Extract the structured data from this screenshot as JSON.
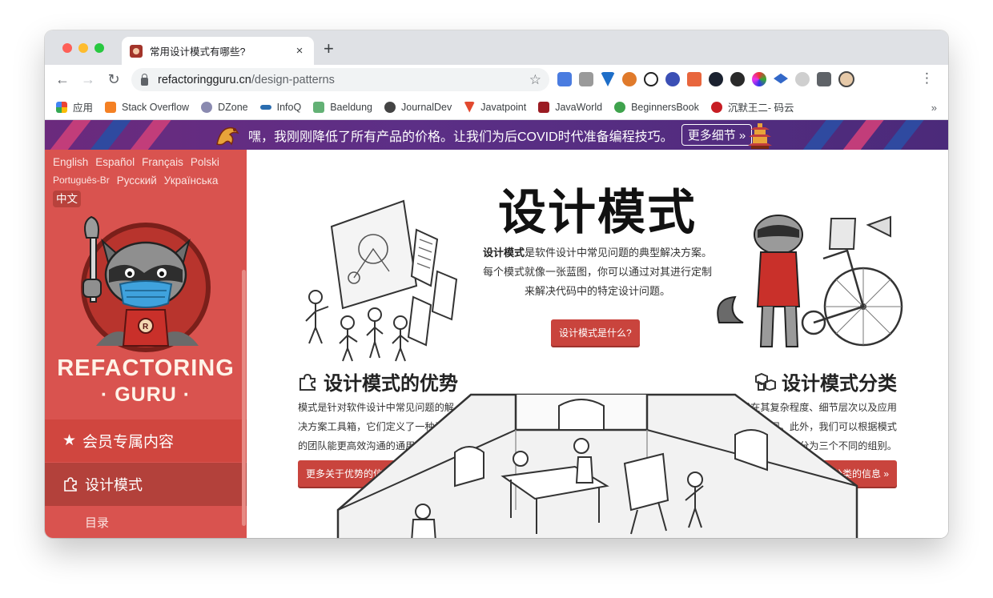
{
  "browser": {
    "tab_title": "常用设计模式有哪些?",
    "tab_close": "×",
    "new_tab": "+",
    "url_host": "refactoringguru.cn",
    "url_path": "/design-patterns",
    "back": "←",
    "forward": "→",
    "reload": "↻",
    "star": "☆",
    "menu": "⋮",
    "bookmarks_more": "»",
    "extension_icons": [
      "translate-icon",
      "screenshot-icon",
      "y-combinator-icon",
      "firefox-relay-icon",
      "ae-icon",
      "sphere-icon",
      "network-icon",
      "play-icon",
      "chat-icon",
      "color-wheel-icon",
      "graduation-cap-icon",
      "sun-icon",
      "puzzle-icon",
      "profile-avatar-icon"
    ]
  },
  "bookmarks": [
    {
      "label": "应用",
      "icon": "apps-grid-icon",
      "color": "#ea4335"
    },
    {
      "label": "Stack Overflow",
      "icon": "stackoverflow-icon",
      "color": "#f48024"
    },
    {
      "label": "DZone",
      "icon": "dzone-icon",
      "color": "#6a6a9a"
    },
    {
      "label": "InfoQ",
      "icon": "infoq-icon",
      "color": "#2a6db0"
    },
    {
      "label": "Baeldung",
      "icon": "baeldung-icon",
      "color": "#63b175"
    },
    {
      "label": "JournalDev",
      "icon": "journaldev-icon",
      "color": "#444444"
    },
    {
      "label": "Javatpoint",
      "icon": "javatpoint-icon",
      "color": "#e2492f"
    },
    {
      "label": "JavaWorld",
      "icon": "javaworld-icon",
      "color": "#9b1c23"
    },
    {
      "label": "BeginnersBook",
      "icon": "beginnersbook-icon",
      "color": "#3fa34d"
    },
    {
      "label": "沉默王二- 码云",
      "icon": "gitee-icon",
      "color": "#c71d23"
    }
  ],
  "banner": {
    "text": "嘿，我刚刚降低了所有产品的价格。让我们为后COVID时代准备编程技巧。",
    "button": "更多细节 »"
  },
  "sidebar": {
    "languages": [
      {
        "label": "English",
        "active": false
      },
      {
        "label": "Español",
        "active": false
      },
      {
        "label": "Français",
        "active": false
      },
      {
        "label": "Polski",
        "active": false
      },
      {
        "label": "Português-Br",
        "active": false
      },
      {
        "label": "Русский",
        "active": false
      },
      {
        "label": "Українська",
        "active": false
      },
      {
        "label": "中文",
        "active": true
      }
    ],
    "logo_line1": "REFACTORING",
    "logo_line2": "· GURU ·",
    "premium_label": "会员专属内容",
    "patterns_label": "设计模式",
    "catalog_label": "目录"
  },
  "main": {
    "title": "设计模式",
    "desc_bold": "设计模式",
    "desc_rest": "是软件设计中常见问题的典型解决方案。每个模式就像一张蓝图，你可以通过对其进行定制来解决代码中的特定设计问题。",
    "what_button": "设计模式是什么?",
    "benefits_title": "设计模式的优势",
    "benefits_text": "模式是针对软件设计中常见问题的解决方案工具箱，它们定义了一种让你的团队能更高效沟通的通用语言。",
    "benefits_button": "更多关于优势的信息 »",
    "classification_title": "设计模式分类",
    "classification_text": "不同设计模式在其复杂程度、细节层次以及应用范围等方面各不相同。此外，我们可以根据模式的目的来将它们划分为三个不同的组别。",
    "classification_button": "更多关于分类的信息 »"
  },
  "colors": {
    "sidebar": "#d9534f",
    "banner": "#5c2f86",
    "button": "#c9443d"
  }
}
